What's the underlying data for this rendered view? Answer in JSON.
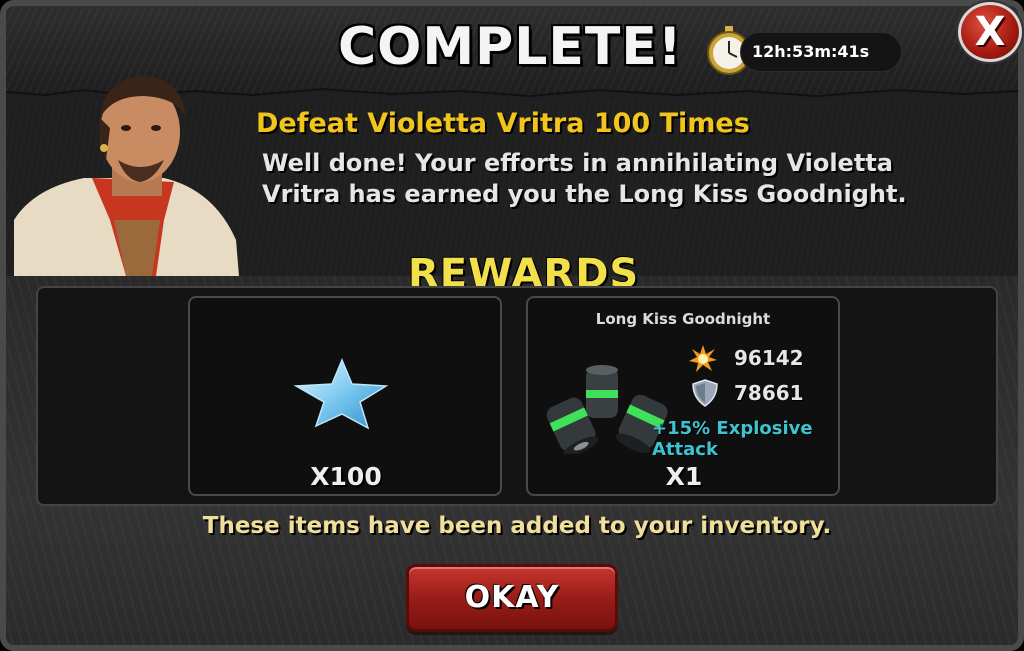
{
  "header": {
    "title": "COMPLETE!",
    "timer": "12h:53m:41s"
  },
  "close": {
    "label": "X"
  },
  "mission": {
    "title": "Defeat Violetta Vritra 100 Times",
    "description": "Well done! Your efforts in annihilating Violetta Vritra has earned you the Long Kiss Goodnight."
  },
  "rewards": {
    "heading": "REWARDS",
    "items": [
      {
        "icon": "star-icon",
        "quantity": "X100"
      },
      {
        "name": "Long Kiss Goodnight",
        "icon": "grenade-icon",
        "attack": "96142",
        "defense": "78661",
        "bonus": "+15% Explosive Attack",
        "quantity": "X1"
      }
    ]
  },
  "footer": {
    "note": "These items have been added to your inventory.",
    "okay_label": "OKAY"
  },
  "colors": {
    "mission_title": "#f2c51c",
    "rewards_heading": "#f2e04a",
    "bonus_text": "#3ec4d0",
    "okay_button": "#c8352e",
    "close_button": "#c23a2b"
  }
}
